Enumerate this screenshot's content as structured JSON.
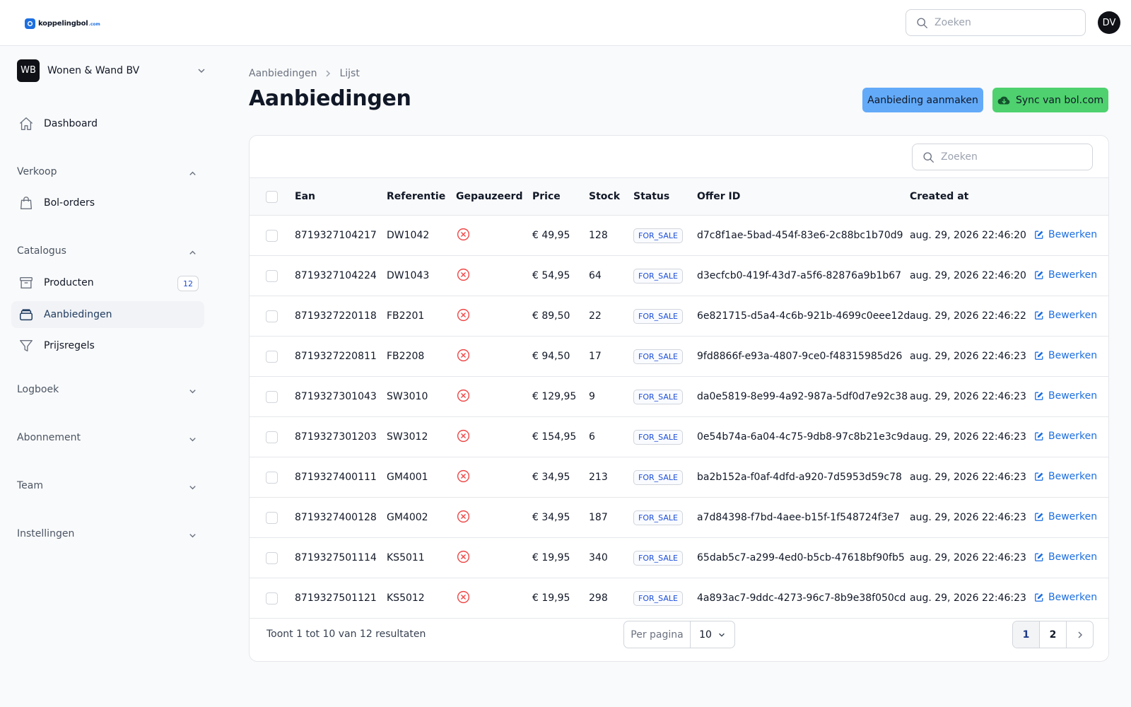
{
  "brand": {
    "name": "koppelingbol",
    "tld": ".com"
  },
  "topbar": {
    "search_placeholder": "Zoeken",
    "avatar_initials": "DV"
  },
  "sidebar": {
    "team": {
      "initials": "WB",
      "name": "Wonen & Wand BV"
    },
    "dashboard_label": "Dashboard",
    "groups": {
      "verkoop": {
        "label": "Verkoop",
        "items": [
          {
            "label": "Bol-orders"
          }
        ]
      },
      "catalogus": {
        "label": "Catalogus",
        "items": [
          {
            "label": "Producten",
            "badge": "12"
          },
          {
            "label": "Aanbiedingen",
            "active": true
          },
          {
            "label": "Prijsregels"
          }
        ]
      },
      "logboek": {
        "label": "Logboek"
      },
      "abonnement": {
        "label": "Abonnement"
      },
      "team": {
        "label": "Team"
      },
      "instellingen": {
        "label": "Instellingen"
      }
    }
  },
  "breadcrumb": [
    "Aanbiedingen",
    "Lijst"
  ],
  "page_title": "Aanbiedingen",
  "actions": {
    "create_label": "Aanbieding aanmaken",
    "sync_label": "Sync van bol.com"
  },
  "table": {
    "search_placeholder": "Zoeken",
    "columns": [
      "Ean",
      "Referentie",
      "Gepauzeerd",
      "Price",
      "Stock",
      "Status",
      "Offer ID",
      "Created at"
    ],
    "edit_label": "Bewerken",
    "rows": [
      {
        "ean": "8719327104217",
        "ref": "DW1042",
        "price": "€ 49,95",
        "stock": "128",
        "status": "FOR_SALE",
        "offer_id": "d7c8f1ae-5bad-454f-83e6-2c88bc1b70d9",
        "created": "aug. 29, 2026 22:46:20"
      },
      {
        "ean": "8719327104224",
        "ref": "DW1043",
        "price": "€ 54,95",
        "stock": "64",
        "status": "FOR_SALE",
        "offer_id": "d3ecfcb0-419f-43d7-a5f6-82876a9b1b67",
        "created": "aug. 29, 2026 22:46:20"
      },
      {
        "ean": "8719327220118",
        "ref": "FB2201",
        "price": "€ 89,50",
        "stock": "22",
        "status": "FOR_SALE",
        "offer_id": "6e821715-d5a4-4c6b-921b-4699c0eee12d",
        "created": "aug. 29, 2026 22:46:22"
      },
      {
        "ean": "8719327220811",
        "ref": "FB2208",
        "price": "€ 94,50",
        "stock": "17",
        "status": "FOR_SALE",
        "offer_id": "9fd8866f-e93a-4807-9ce0-f48315985d26",
        "created": "aug. 29, 2026 22:46:23"
      },
      {
        "ean": "8719327301043",
        "ref": "SW3010",
        "price": "€ 129,95",
        "stock": "9",
        "status": "FOR_SALE",
        "offer_id": "da0e5819-8e99-4a92-987a-5df0d7e92c38",
        "created": "aug. 29, 2026 22:46:23"
      },
      {
        "ean": "8719327301203",
        "ref": "SW3012",
        "price": "€ 154,95",
        "stock": "6",
        "status": "FOR_SALE",
        "offer_id": "0e54b74a-6a04-4c75-9db8-97c8b21e3c9d",
        "created": "aug. 29, 2026 22:46:23"
      },
      {
        "ean": "8719327400111",
        "ref": "GM4001",
        "price": "€ 34,95",
        "stock": "213",
        "status": "FOR_SALE",
        "offer_id": "ba2b152a-f0af-4dfd-a920-7d5953d59c78",
        "created": "aug. 29, 2026 22:46:23"
      },
      {
        "ean": "8719327400128",
        "ref": "GM4002",
        "price": "€ 34,95",
        "stock": "187",
        "status": "FOR_SALE",
        "offer_id": "a7d84398-f7bd-4aee-b15f-1f548724f3e7",
        "created": "aug. 29, 2026 22:46:23"
      },
      {
        "ean": "8719327501114",
        "ref": "KS5011",
        "price": "€ 19,95",
        "stock": "340",
        "status": "FOR_SALE",
        "offer_id": "65dab5c7-a299-4ed0-b5cb-47618bf90fb5",
        "created": "aug. 29, 2026 22:46:23"
      },
      {
        "ean": "8719327501121",
        "ref": "KS5012",
        "price": "€ 19,95",
        "stock": "298",
        "status": "FOR_SALE",
        "offer_id": "4a893ac7-9ddc-4273-96c7-8b9e38f050cd",
        "created": "aug. 29, 2026 22:46:23"
      }
    ]
  },
  "footer": {
    "results_text": "Toont 1 tot 10 van 12 resultaten",
    "per_page_label": "Per pagina",
    "per_page_value": "10",
    "pages": [
      "1",
      "2"
    ],
    "current_page": "1"
  },
  "colors": {
    "primary_button": "#63aaf9",
    "sync_button": "#4ed16e",
    "link": "#1d6fe0",
    "paused_icon": "#ef4444"
  },
  "icons": {
    "search": "search-icon",
    "home": "home-icon",
    "bag": "shopping-bag-icon",
    "archive": "archive-box-icon",
    "stack": "stack-icon",
    "filter": "funnel-icon",
    "cloud": "cloud-download-icon",
    "edit": "pencil-square-icon",
    "paused": "x-circle-icon"
  }
}
